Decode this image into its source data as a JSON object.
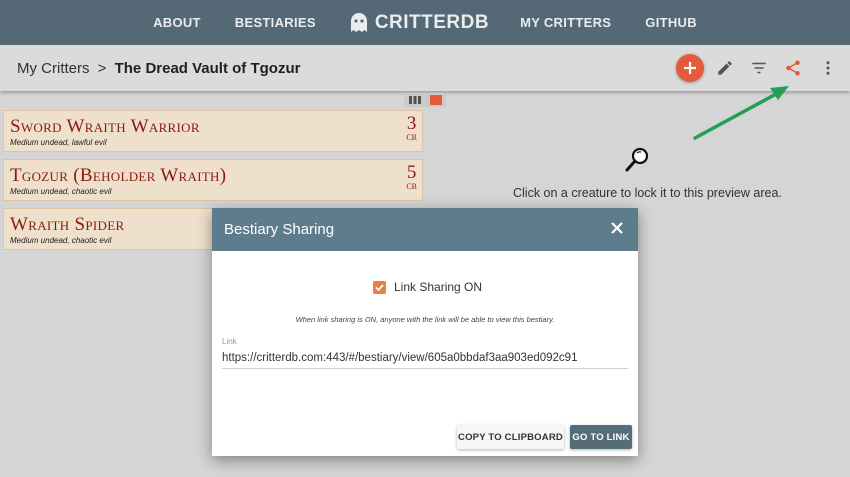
{
  "nav": {
    "about": "ABOUT",
    "bestiaries": "BESTIARIES",
    "brand": "CRITTERDB",
    "my_critters": "MY CRITTERS",
    "github": "GITHUB"
  },
  "breadcrumb": {
    "parent": "My Critters",
    "separator": ">",
    "current": "The Dread Vault of Tgozur"
  },
  "toolbar": {
    "add_icon": "plus",
    "add_color": "#e85c3f",
    "share_color": "#e85c3f"
  },
  "creatures": [
    {
      "name": "Sword Wraith Warrior",
      "type": "Medium undead, lawful evil",
      "cr": "3",
      "cr_label": "CR"
    },
    {
      "name": "Tgozur (Beholder Wraith)",
      "type": "Medium undead, chaotic evil",
      "cr": "5",
      "cr_label": "CR"
    },
    {
      "name": "Wraith Spider",
      "type": "Medium undead, chaotic evil",
      "cr": "",
      "cr_label": ""
    }
  ],
  "preview": {
    "message": "Click on a creature to lock it to this preview area."
  },
  "dialog": {
    "title": "Bestiary Sharing",
    "checkbox_label": "Link Sharing ON",
    "checkbox_checked": true,
    "info": "When link sharing is ON, anyone with the link will be able to view this bestiary.",
    "link_label": "Link",
    "link_value": "https://critterdb.com:443/#/bestiary/view/605a0bbdaf3aa903ed092c91",
    "copy_button": "COPY TO CLIPBOARD",
    "go_button": "GO TO LINK"
  },
  "colors": {
    "nav_bg": "#566c78",
    "dialog_header": "#5d7d8c",
    "creature_name": "#8b1c12",
    "card_bg": "#f4e5d0",
    "annotation_arrow": "#22a35a"
  }
}
